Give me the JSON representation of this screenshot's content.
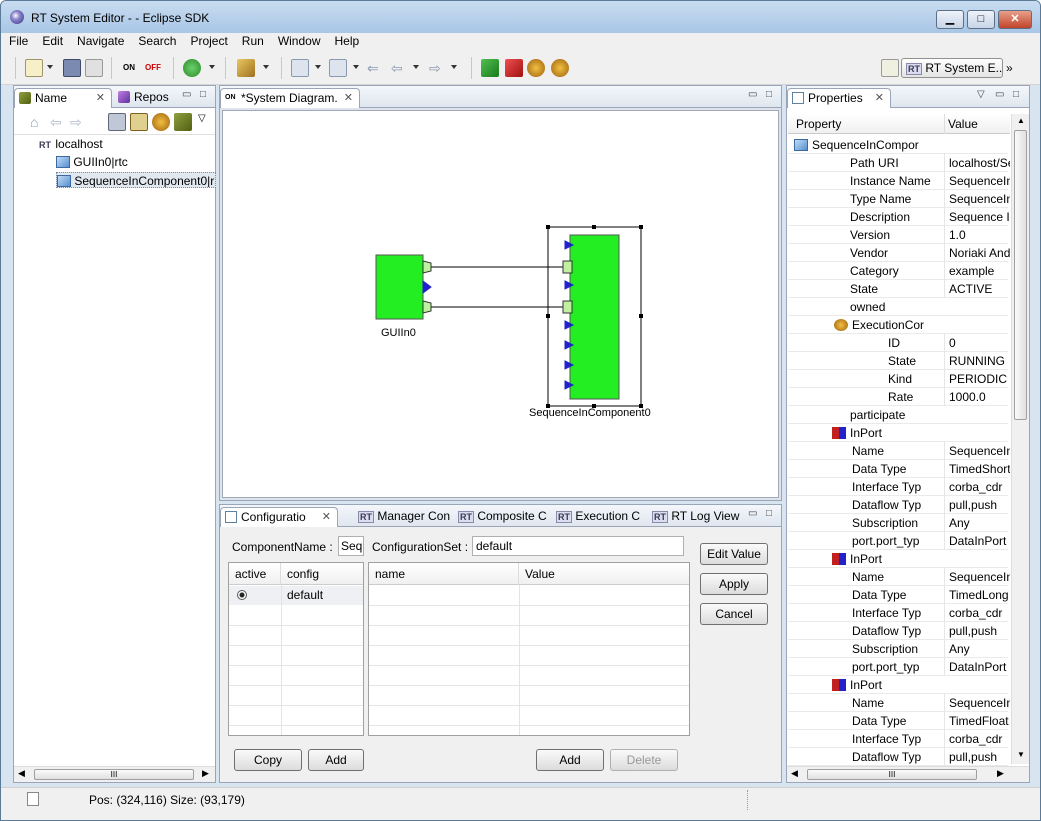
{
  "window": {
    "title": "RT System Editor -  - Eclipse SDK",
    "minimize": "▁",
    "maximize": "□",
    "close": "✕"
  },
  "menu": [
    "File",
    "Edit",
    "Navigate",
    "Search",
    "Project",
    "Run",
    "Window",
    "Help"
  ],
  "perspective": {
    "label": "RT System E...",
    "badge": "RT"
  },
  "left_panel": {
    "tabs": [
      {
        "label": "Name"
      },
      {
        "label": "Repos"
      }
    ],
    "tree": [
      {
        "label": "localhost",
        "badge": "RT"
      },
      {
        "label": "GUIIn0|rtc"
      },
      {
        "label": "SequenceInComponent0|r"
      }
    ],
    "hscroll_grip": "III"
  },
  "editor": {
    "tab": "*System Diagram.",
    "components": [
      {
        "name": "GUIIn0"
      },
      {
        "name": "SequenceInComponent0"
      }
    ]
  },
  "properties": {
    "tab": "Properties",
    "col_property": "Property",
    "col_value": "Value",
    "rows": [
      {
        "k": "SequenceInCompor",
        "v": "",
        "indent": 0,
        "icon": "component"
      },
      {
        "k": "Path URI",
        "v": "localhost/Se",
        "indent": 1
      },
      {
        "k": "Instance Name",
        "v": "SequenceIn",
        "indent": 1
      },
      {
        "k": "Type Name",
        "v": "SequenceIn",
        "indent": 1
      },
      {
        "k": "Description",
        "v": "Sequence In",
        "indent": 1
      },
      {
        "k": "Version",
        "v": "1.0",
        "indent": 1
      },
      {
        "k": "Vendor",
        "v": "Noriaki And",
        "indent": 1
      },
      {
        "k": "Category",
        "v": "example",
        "indent": 1
      },
      {
        "k": "State",
        "v": "ACTIVE",
        "indent": 1
      },
      {
        "k": "owned",
        "v": "",
        "indent": 1
      },
      {
        "k": "ExecutionCor",
        "v": "",
        "indent": 2,
        "icon": "gear"
      },
      {
        "k": "ID",
        "v": "0",
        "indent": 3
      },
      {
        "k": "State",
        "v": "RUNNING",
        "indent": 3
      },
      {
        "k": "Kind",
        "v": "PERIODIC",
        "indent": 3
      },
      {
        "k": "Rate",
        "v": "1000.0",
        "indent": 3
      },
      {
        "k": "participate",
        "v": "",
        "indent": 1
      },
      {
        "k": "InPort",
        "v": "",
        "indent": 1,
        "icon": "inport"
      },
      {
        "k": "Name",
        "v": "SequenceIn",
        "indent": 2
      },
      {
        "k": "Data Type",
        "v": "TimedShort",
        "indent": 2
      },
      {
        "k": "Interface Typ",
        "v": "corba_cdr",
        "indent": 2
      },
      {
        "k": "Dataflow Typ",
        "v": "pull,push",
        "indent": 2
      },
      {
        "k": "Subscription",
        "v": "Any",
        "indent": 2
      },
      {
        "k": "port.port_typ",
        "v": "DataInPort",
        "indent": 2
      },
      {
        "k": "InPort",
        "v": "",
        "indent": 1,
        "icon": "inport"
      },
      {
        "k": "Name",
        "v": "SequenceIn",
        "indent": 2
      },
      {
        "k": "Data Type",
        "v": "TimedLong",
        "indent": 2
      },
      {
        "k": "Interface Typ",
        "v": "corba_cdr",
        "indent": 2
      },
      {
        "k": "Dataflow Typ",
        "v": "pull,push",
        "indent": 2
      },
      {
        "k": "Subscription",
        "v": "Any",
        "indent": 2
      },
      {
        "k": "port.port_typ",
        "v": "DataInPort",
        "indent": 2
      },
      {
        "k": "InPort",
        "v": "",
        "indent": 1,
        "icon": "inport"
      },
      {
        "k": "Name",
        "v": "SequenceIn",
        "indent": 2
      },
      {
        "k": "Data Type",
        "v": "TimedFloat",
        "indent": 2
      },
      {
        "k": "Interface Typ",
        "v": "corba_cdr",
        "indent": 2
      },
      {
        "k": "Dataflow Typ",
        "v": "pull,push",
        "indent": 2
      }
    ],
    "hscroll_grip": "III"
  },
  "bottom": {
    "tabs": [
      {
        "label": "Configuratio"
      },
      {
        "label": "Manager Con",
        "badge": "RT"
      },
      {
        "label": "Composite C",
        "badge": "RT"
      },
      {
        "label": "Execution C",
        "badge": "RT"
      },
      {
        "label": "RT Log View",
        "badge": "RT"
      }
    ],
    "component_name_label": "ComponentName :",
    "component_name_value": "Sequ",
    "config_set_label": "ConfigurationSet :",
    "config_set_value": "default",
    "left_grid": {
      "col_active": "active",
      "col_config": "config",
      "rows": [
        {
          "config": "default"
        }
      ]
    },
    "right_grid": {
      "col_name": "name",
      "col_value": "Value"
    },
    "buttons": {
      "edit_value": "Edit Value",
      "apply": "Apply",
      "cancel": "Cancel",
      "copy": "Copy",
      "add_left": "Add",
      "add_right": "Add",
      "delete": "Delete"
    }
  },
  "status": {
    "text": "Pos: (324,116) Size: (93,179)"
  }
}
